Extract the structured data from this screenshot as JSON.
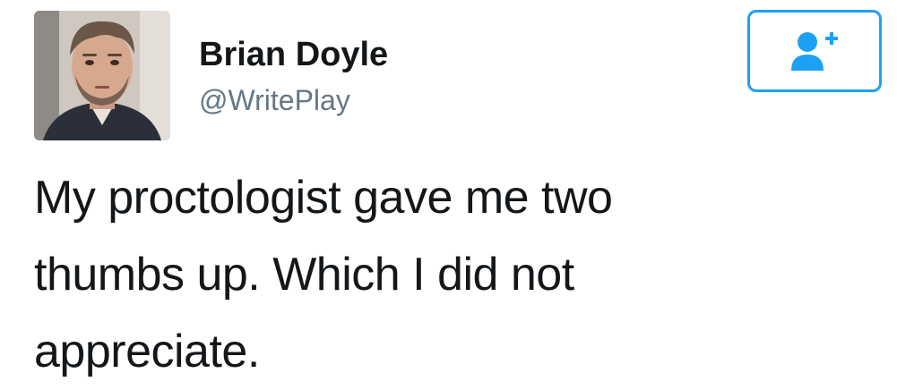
{
  "user": {
    "display_name": "Brian Doyle",
    "handle": "@WritePlay"
  },
  "follow_button": {
    "icon": "add-user-icon",
    "color": "#1da1f2"
  },
  "tweet": {
    "lines": [
      "My proctologist gave me two",
      "thumbs up. Which I did not",
      "appreciate."
    ]
  },
  "colors": {
    "text": "#14171a",
    "secondary_text": "#657786",
    "accent": "#1da1f2",
    "background": "#ffffff"
  }
}
